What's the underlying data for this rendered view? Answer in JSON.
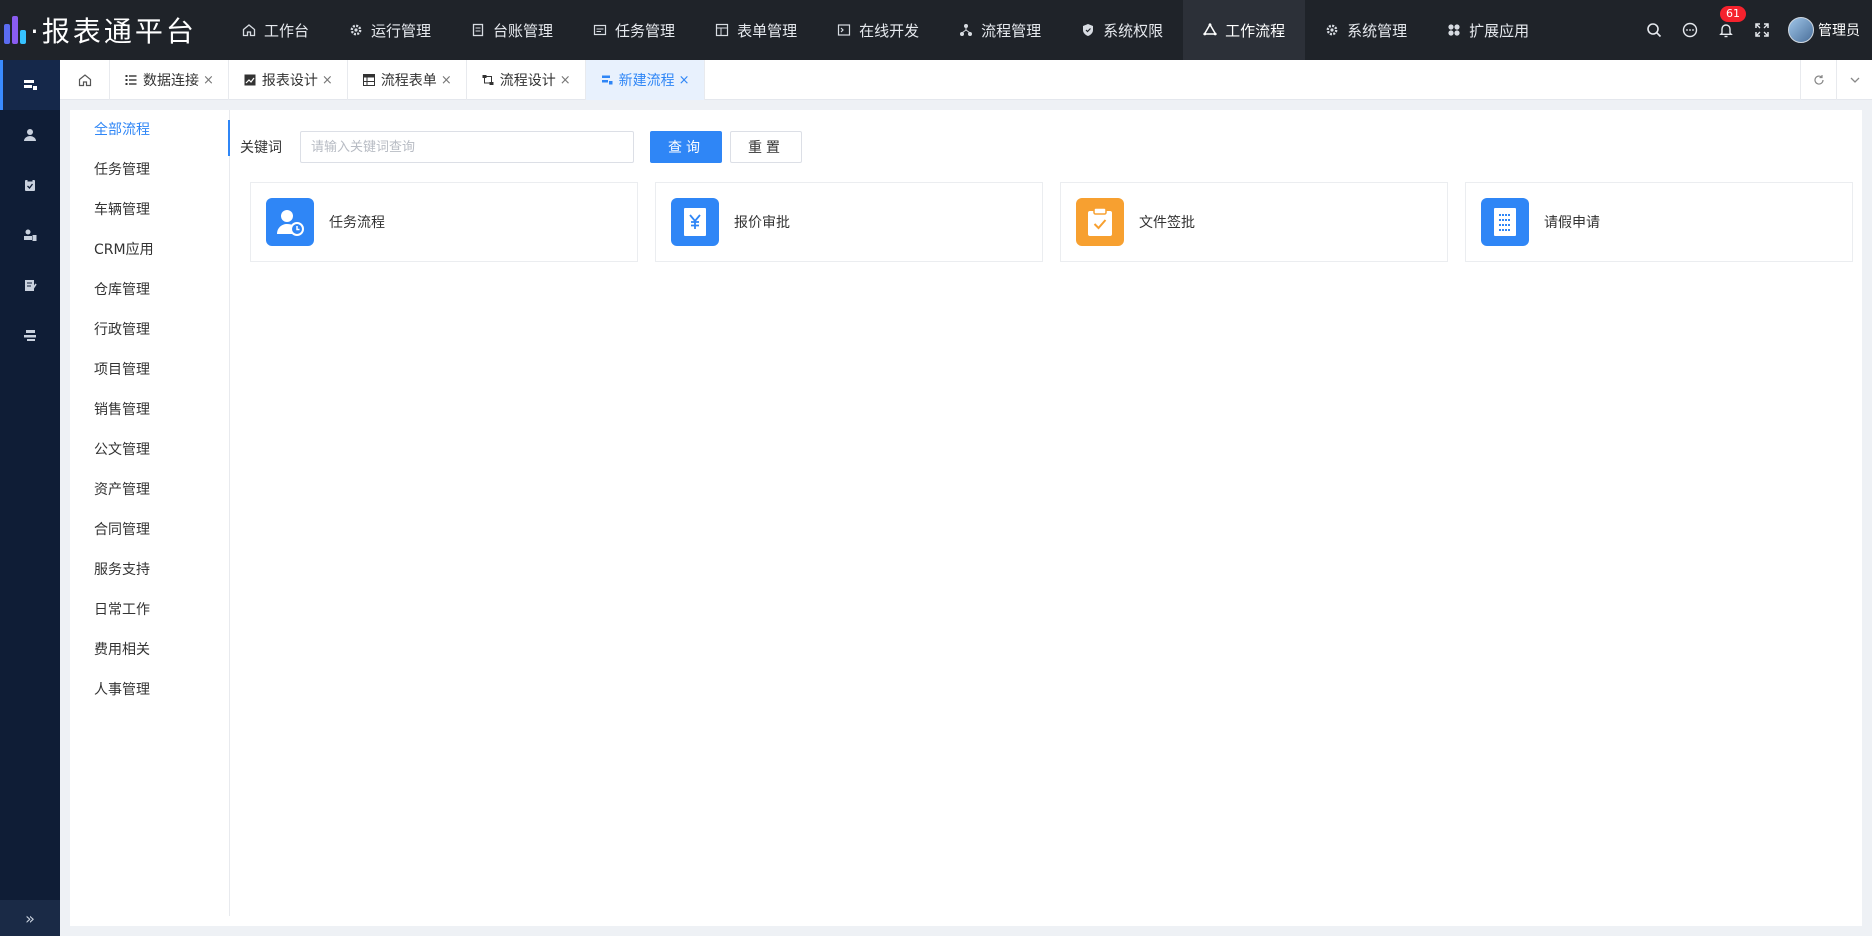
{
  "app": {
    "logo_text": "·报表通平台"
  },
  "nav": {
    "items": [
      {
        "label": "工作台",
        "icon": "home-icon"
      },
      {
        "label": "运行管理",
        "icon": "gear-icon"
      },
      {
        "label": "台账管理",
        "icon": "ledger-icon"
      },
      {
        "label": "任务管理",
        "icon": "task-icon"
      },
      {
        "label": "表单管理",
        "icon": "form-icon"
      },
      {
        "label": "在线开发",
        "icon": "terminal-icon"
      },
      {
        "label": "流程管理",
        "icon": "flow-icon"
      },
      {
        "label": "系统权限",
        "icon": "shield-icon"
      },
      {
        "label": "工作流程",
        "icon": "workflow-icon",
        "active": true
      },
      {
        "label": "系统管理",
        "icon": "gear-icon"
      },
      {
        "label": "扩展应用",
        "icon": "apps-icon"
      }
    ]
  },
  "header_right": {
    "notification_count": "61",
    "user_name": "管理员"
  },
  "tabs": {
    "items": [
      {
        "label": "数据连接",
        "icon": "list-icon"
      },
      {
        "label": "报表设计",
        "icon": "chart-icon"
      },
      {
        "label": "流程表单",
        "icon": "table-icon"
      },
      {
        "label": "流程设计",
        "icon": "flow-design-icon"
      },
      {
        "label": "新建流程",
        "icon": "new-flow-icon",
        "active": true
      }
    ],
    "close_glyph": "×"
  },
  "categories": [
    "全部流程",
    "任务管理",
    "车辆管理",
    "CRM应用",
    "仓库管理",
    "行政管理",
    "项目管理",
    "销售管理",
    "公文管理",
    "资产管理",
    "合同管理",
    "服务支持",
    "日常工作",
    "费用相关",
    "人事管理"
  ],
  "search": {
    "label": "关键词",
    "placeholder": "请输入关键词查询",
    "query_button": "查询",
    "reset_button": "重置"
  },
  "cards": [
    {
      "title": "任务流程",
      "icon": "user-clock-icon",
      "color": "#2f86f6"
    },
    {
      "title": "报价审批",
      "icon": "yuan-document-icon",
      "color": "#2f86f6"
    },
    {
      "title": "文件签批",
      "icon": "clipboard-check-icon",
      "color": "#f7a030"
    },
    {
      "title": "请假申请",
      "icon": "list-document-icon",
      "color": "#2f86f6"
    }
  ],
  "colors": {
    "accent": "#2f86f6",
    "topbar": "#1f2329",
    "rail": "#0f1d36",
    "badge": "#f5222d"
  }
}
